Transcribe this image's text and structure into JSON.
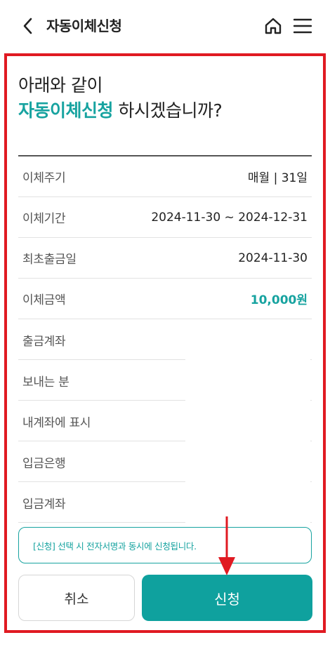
{
  "header": {
    "title": "자동이체신청",
    "back_icon": "chevron-left-icon",
    "home_icon": "home-icon",
    "menu_icon": "hamburger-menu-icon"
  },
  "question": {
    "line1": "아래와 같이",
    "accent": "자동이체신청",
    "rest": " 하시겠습니까?"
  },
  "details": [
    {
      "label": "이체주기",
      "value": "매월 | 31일"
    },
    {
      "label": "이체기간",
      "value": "2024-11-30 ~ 2024-12-31"
    },
    {
      "label": "최초출금일",
      "value": "2024-11-30"
    },
    {
      "label": "이체금액",
      "value": "10,000원"
    },
    {
      "label": "출금계좌",
      "value": ""
    },
    {
      "label": "보내는 분",
      "value": ""
    },
    {
      "label": "내계좌에 표시",
      "value": ""
    },
    {
      "label": "입금은행",
      "value": ""
    },
    {
      "label": "입금계좌",
      "value": ""
    }
  ],
  "notice": "[신청] 선택 시 전자서명과 동시에 신청됩니다.",
  "buttons": {
    "cancel": "취소",
    "submit": "신청"
  },
  "colors": {
    "accent": "#17a3a0",
    "submit_bg": "#0fa19e",
    "highlight_frame": "#e01a22"
  }
}
